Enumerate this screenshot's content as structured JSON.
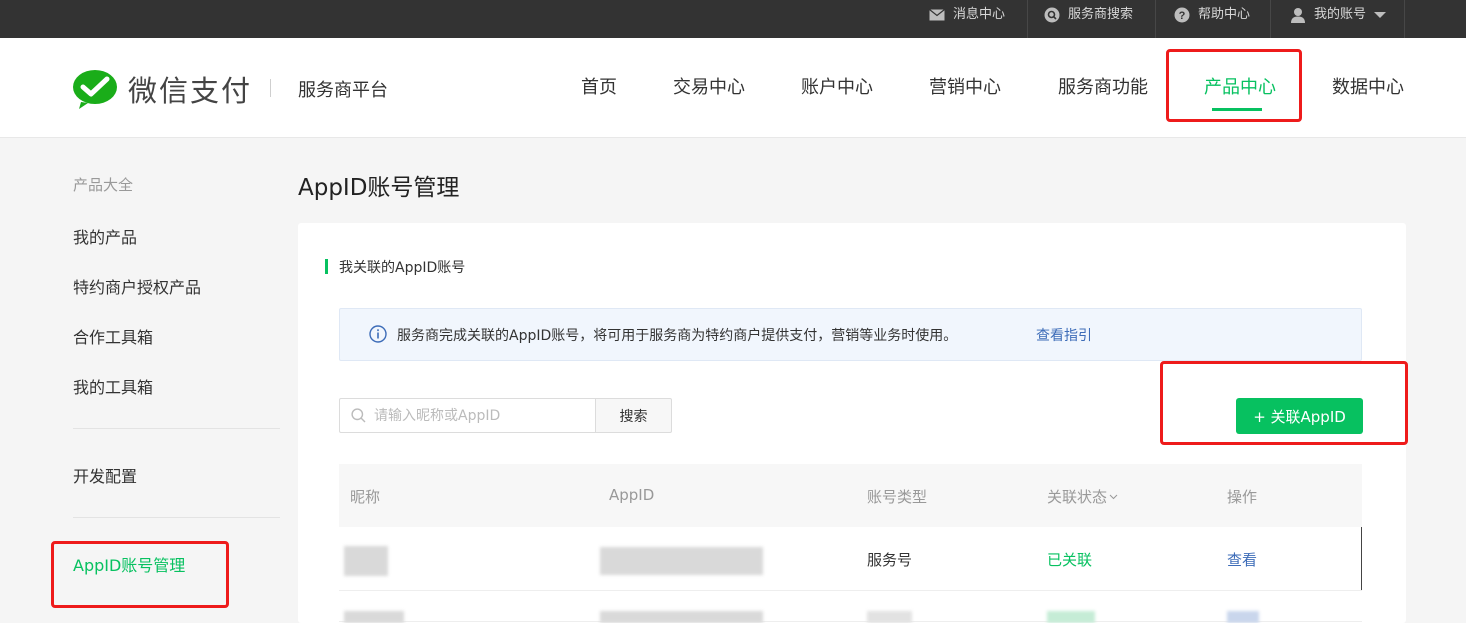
{
  "topbar": {
    "messages": "消息中心",
    "provider_search": "服务商搜索",
    "help": "帮助中心",
    "account": "我的账号"
  },
  "header": {
    "logo_text": "微信支付",
    "platform": "服务商平台",
    "nav": [
      "首页",
      "交易中心",
      "账户中心",
      "营销中心",
      "服务商功能",
      "产品中心",
      "数据中心"
    ],
    "active_nav": "产品中心"
  },
  "sidebar": {
    "group_title": "产品大全",
    "items": [
      "我的产品",
      "特约商户授权产品",
      "合作工具箱",
      "我的工具箱"
    ],
    "dev_config": "开发配置",
    "active_item": "AppID账号管理"
  },
  "main": {
    "title": "AppID账号管理",
    "section_title": "我关联的AppID账号",
    "notice": "服务商完成关联的AppID账号，将可用于服务商为特约商户提供支付，营销等业务时使用。",
    "notice_link": "查看指引",
    "search_placeholder": "请输入昵称或AppID",
    "search_button": "搜索",
    "add_button": "+ 关联AppID",
    "table": {
      "headers": [
        "昵称",
        "AppID",
        "账号类型",
        "关联状态",
        "操作"
      ],
      "rows": [
        {
          "type": "服务号",
          "status": "已关联",
          "action": "查看"
        }
      ]
    }
  },
  "colors": {
    "accent_green": "#07c160",
    "link_blue": "#3d6cb8",
    "highlight_red": "#ee1b1b"
  }
}
